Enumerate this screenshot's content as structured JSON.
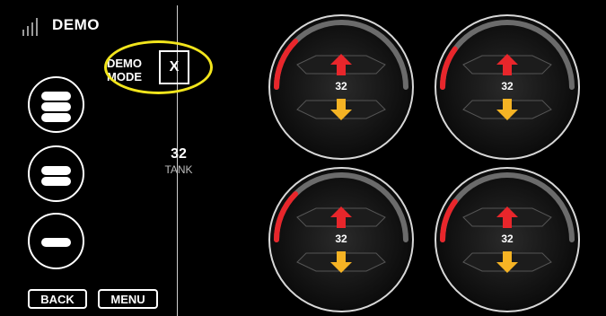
{
  "header": {
    "title": "DEMO",
    "signal_icon": "signal-bars-icon"
  },
  "demo_mode": {
    "label_line1": "DEMO",
    "label_line2": "MODE",
    "close_label": "X",
    "highlight_color": "#f2e51c"
  },
  "level_buttons": [
    {
      "name": "level-high-button",
      "bars": 3
    },
    {
      "name": "level-mid-button",
      "bars": 2
    },
    {
      "name": "level-low-button",
      "bars": 1
    }
  ],
  "tank": {
    "value": "32",
    "label": "TANK"
  },
  "footer": {
    "back_label": "BACK",
    "menu_label": "MENU"
  },
  "gauges": [
    {
      "value": "32",
      "fill_fraction": 0.25
    },
    {
      "value": "32",
      "fill_fraction": 0.2
    },
    {
      "value": "32",
      "fill_fraction": 0.25
    },
    {
      "value": "32",
      "fill_fraction": 0.2
    }
  ],
  "colors": {
    "accent_red": "#e8262b",
    "accent_yellow": "#f5b324",
    "track_gray": "#6b6b6b"
  }
}
